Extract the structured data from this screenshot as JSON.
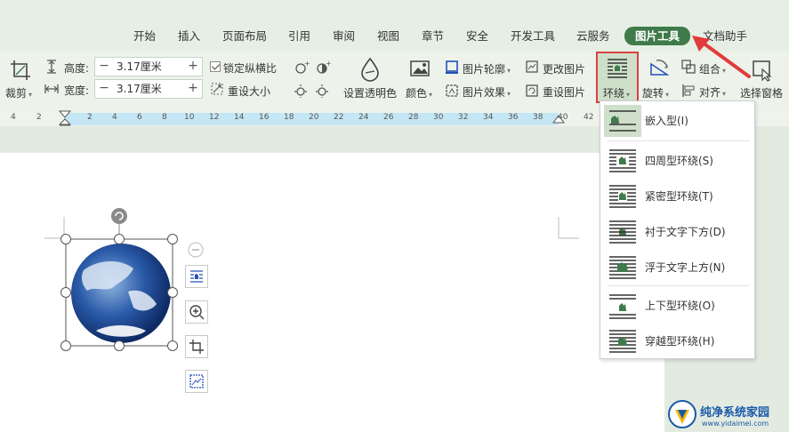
{
  "tabs": {
    "items": [
      "开始",
      "插入",
      "页面布局",
      "引用",
      "审阅",
      "视图",
      "章节",
      "安全",
      "开发工具",
      "云服务",
      "图片工具",
      "文档助手"
    ],
    "active": "图片工具"
  },
  "ribbon": {
    "crop_label": "裁剪",
    "height_label": "高度:",
    "height_value": "3.17厘米",
    "width_label": "宽度:",
    "width_value": "3.17厘米",
    "lock_ratio_label": "锁定纵横比",
    "reset_size_label": "重设大小",
    "transparent_label": "设置透明色",
    "color_label": "颜色",
    "outline_label": "图片轮廓",
    "effect_label": "图片效果",
    "change_pic_label": "更改图片",
    "reset_pic_label": "重设图片",
    "wrap_label": "环绕",
    "rotate_label": "旋转",
    "group_label": "组合",
    "align_label": "对齐",
    "selection_pane_label": "选择窗格"
  },
  "ruler": {
    "ticks": [
      "4",
      "2",
      "2",
      "4",
      "6",
      "8",
      "10",
      "12",
      "14",
      "16",
      "18",
      "20",
      "22",
      "24",
      "26",
      "28",
      "30",
      "32",
      "34",
      "36",
      "38",
      "40",
      "42"
    ]
  },
  "wrap_menu": {
    "items": [
      {
        "label": "嵌入型(I)",
        "selected": true
      },
      {
        "label": "四周型环绕(S)",
        "selected": false
      },
      {
        "label": "紧密型环绕(T)",
        "selected": false
      },
      {
        "label": "衬于文字下方(D)",
        "selected": false
      },
      {
        "label": "浮于文字上方(N)",
        "selected": false
      },
      {
        "label": "上下型环绕(O)",
        "selected": false
      },
      {
        "label": "穿越型环绕(H)",
        "selected": false
      }
    ]
  },
  "float_toolbar": {
    "icons": [
      "layout-options-icon",
      "zoom-icon",
      "crop-icon",
      "picture-fill-icon"
    ]
  },
  "watermark": {
    "title": "纯净系统家园",
    "url": "www.yidaimei.com"
  },
  "colors": {
    "accent_green": "#3f7a4a",
    "highlight_red": "#d94040",
    "ribbon_bg": "#edf3eb",
    "ruler_blue": "#c5e6f4"
  }
}
